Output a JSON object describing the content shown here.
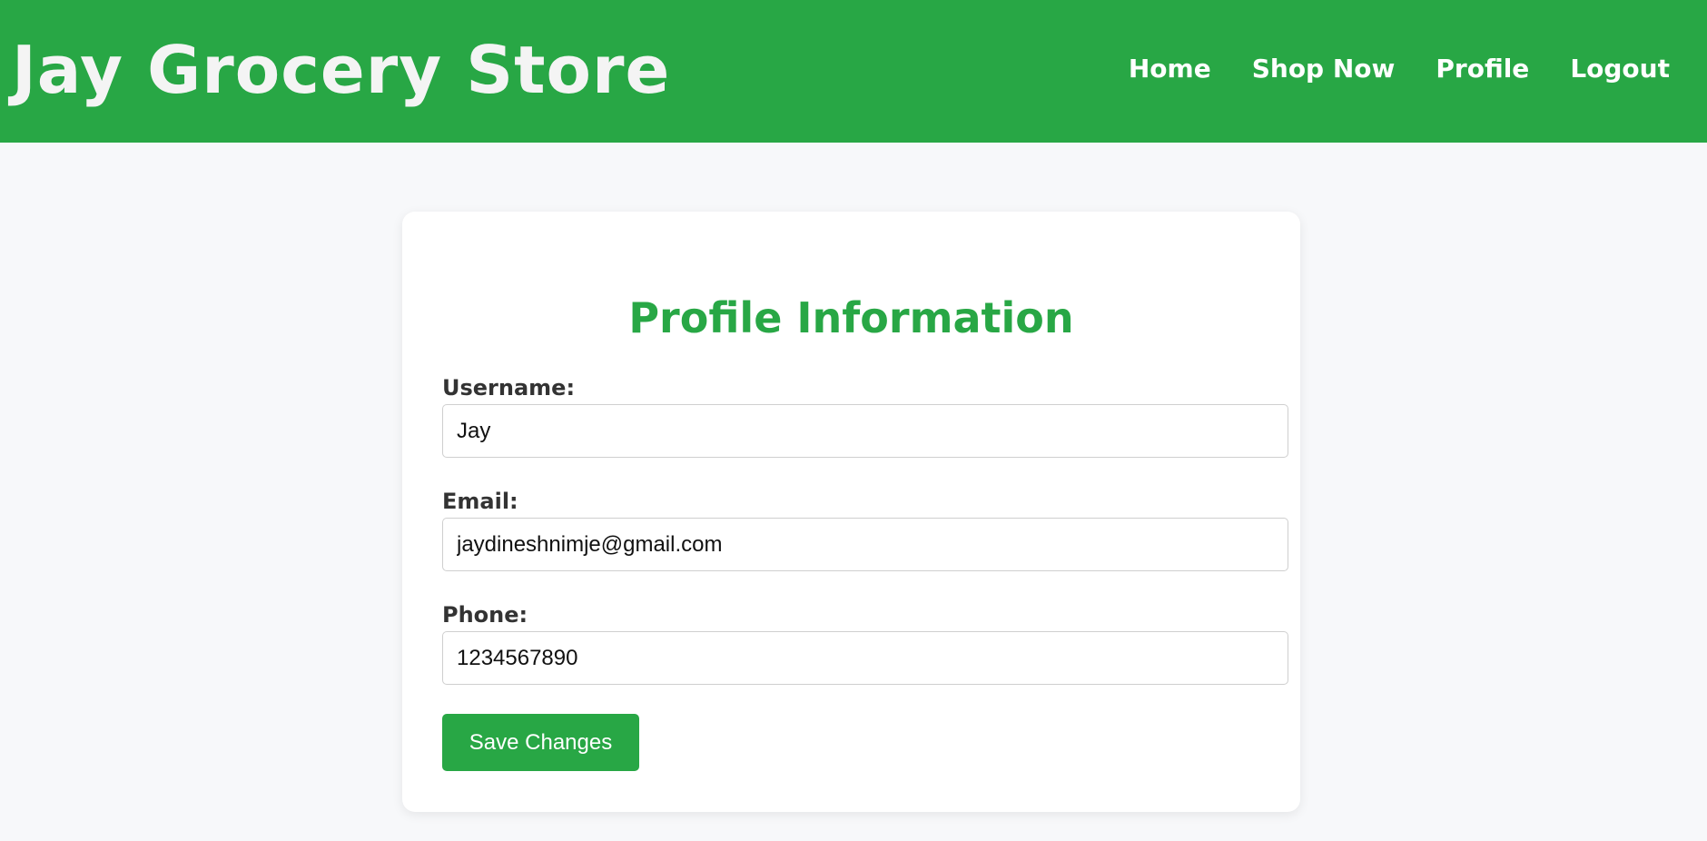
{
  "header": {
    "brand": "Jay Grocery Store",
    "nav": [
      {
        "label": "Home"
      },
      {
        "label": "Shop Now"
      },
      {
        "label": "Profile"
      },
      {
        "label": "Logout"
      }
    ]
  },
  "profile": {
    "title": "Profile Information",
    "username": {
      "label": "Username:",
      "value": "Jay"
    },
    "email": {
      "label": "Email:",
      "value": "jaydineshnimje@gmail.com"
    },
    "phone": {
      "label": "Phone:",
      "value": "1234567890"
    },
    "save_label": "Save Changes"
  },
  "colors": {
    "brand_green": "#28a745",
    "background": "#f7f8fa",
    "card": "#ffffff",
    "label_text": "#333333"
  }
}
